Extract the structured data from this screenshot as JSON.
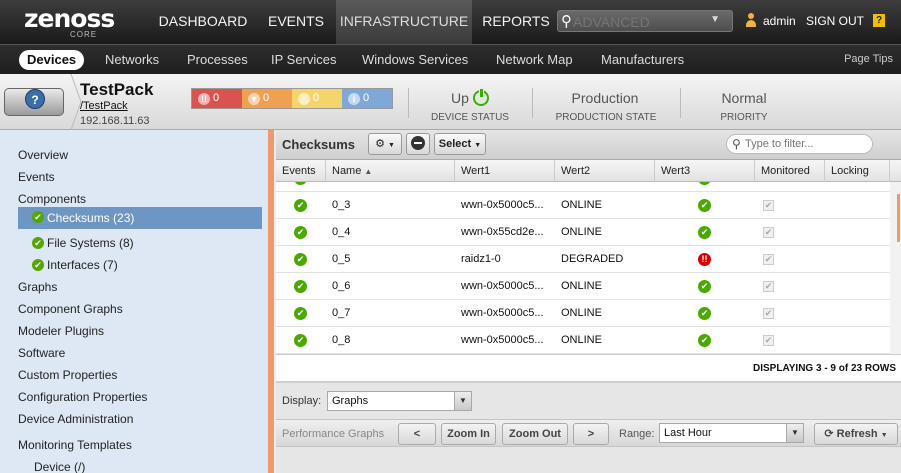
{
  "brand": {
    "name": "zenoss",
    "sub": "CORE"
  },
  "nav": {
    "items": [
      "DASHBOARD",
      "EVENTS",
      "INFRASTRUCTURE",
      "REPORTS"
    ],
    "active": "INFRASTRUCTURE",
    "search_placeholder": "ADVANCED",
    "user": "admin",
    "signout": "SIGN OUT",
    "help": "?"
  },
  "subnav": {
    "items": [
      "Devices",
      "Networks",
      "Processes",
      "IP Services",
      "Windows Services",
      "Network Map",
      "Manufacturers"
    ],
    "active": "Devices",
    "page_tips": "Page Tips"
  },
  "device": {
    "title": "TestPack",
    "path": "/TestPack",
    "ip": "192.168.11.63",
    "events": [
      {
        "severity": "critical",
        "symbol": "!!",
        "count": "0",
        "color": "#d9534f"
      },
      {
        "severity": "error",
        "symbol": "▼",
        "count": "0",
        "color": "#f0a050"
      },
      {
        "severity": "warning",
        "symbol": "△",
        "count": "0",
        "color": "#f5d46b"
      },
      {
        "severity": "info",
        "symbol": "i",
        "count": "0",
        "color": "#7fa8d6"
      }
    ],
    "status": {
      "value": "Up",
      "label": "DEVICE STATUS"
    },
    "production": {
      "value": "Production",
      "label": "PRODUCTION STATE"
    },
    "priority": {
      "value": "Normal",
      "label": "PRIORITY"
    }
  },
  "sidebar": {
    "items": [
      {
        "label": "Overview"
      },
      {
        "label": "Events"
      },
      {
        "label": "Components"
      },
      {
        "label": "Checksums (23)",
        "sub": true,
        "active": true
      },
      {
        "label": "File Systems (8)",
        "sub": true
      },
      {
        "label": "Interfaces (7)",
        "sub": true
      },
      {
        "label": "Graphs"
      },
      {
        "label": "Component Graphs"
      },
      {
        "label": "Modeler Plugins"
      },
      {
        "label": "Software"
      },
      {
        "label": "Custom Properties"
      },
      {
        "label": "Configuration Properties"
      },
      {
        "label": "Device Administration"
      },
      {
        "label": "Monitoring Templates"
      },
      {
        "label": "Device (/)"
      }
    ]
  },
  "grid": {
    "title": "Checksums",
    "select_label": "Select",
    "filter_placeholder": "Type to filter...",
    "columns": [
      "Events",
      "Name",
      "Wert1",
      "Wert2",
      "Wert3",
      "Monitored",
      "Locking"
    ],
    "sort_column": "Name",
    "sort_arrow": "▲",
    "rows": [
      {
        "event": "ok",
        "name": "0_3",
        "wert1": "wwn-0x5000c5...",
        "wert2": "ONLINE",
        "wert3": "ok",
        "monitored": true
      },
      {
        "event": "ok",
        "name": "0_4",
        "wert1": "wwn-0x55cd2e...",
        "wert2": "ONLINE",
        "wert3": "ok",
        "monitored": true
      },
      {
        "event": "ok",
        "name": "0_5",
        "wert1": "raidz1-0",
        "wert2": "DEGRADED",
        "wert3": "critical",
        "monitored": true
      },
      {
        "event": "ok",
        "name": "0_6",
        "wert1": "wwn-0x5000c5...",
        "wert2": "ONLINE",
        "wert3": "ok",
        "monitored": true
      },
      {
        "event": "ok",
        "name": "0_7",
        "wert1": "wwn-0x5000c5...",
        "wert2": "ONLINE",
        "wert3": "ok",
        "monitored": true
      },
      {
        "event": "ok",
        "name": "0_8",
        "wert1": "wwn-0x5000c5...",
        "wert2": "ONLINE",
        "wert3": "ok",
        "monitored": true
      }
    ],
    "paging": "DISPLAYING 3 - 9 of 23 ROWS"
  },
  "bottom": {
    "display_label": "Display:",
    "display_value": "Graphs",
    "perf_label": "Performance Graphs",
    "prev": "<",
    "zoom_in": "Zoom In",
    "zoom_out": "Zoom Out",
    "next": ">",
    "range_label": "Range:",
    "range_value": "Last Hour",
    "refresh": "Refresh"
  }
}
